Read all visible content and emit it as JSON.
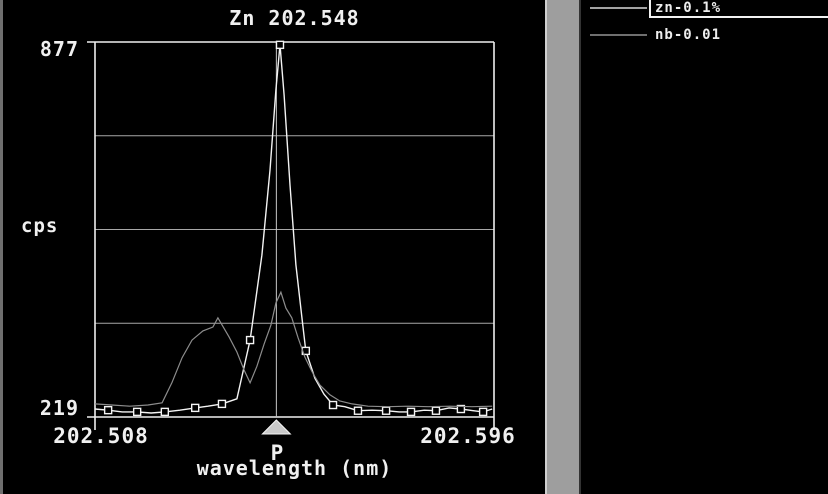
{
  "chart": {
    "title": "Zn 202.548",
    "y_axis": {
      "label": "cps",
      "max_label": "877",
      "min_label": "219"
    },
    "x_axis": {
      "label": "wavelength (nm)",
      "min_label": "202.508",
      "max_label": "202.596"
    },
    "peak_marker_label": "P"
  },
  "legend": {
    "items": [
      {
        "id": "zn",
        "label": "zn-0.1%",
        "sample_color": "#a2a2a2",
        "selected": true
      },
      {
        "id": "nb",
        "label": "nb-0.01",
        "sample_color": "#6f6f6f",
        "selected": false
      }
    ]
  },
  "colors": {
    "background": "#000000",
    "axis": "#efefef",
    "grid": "#a8a8a8",
    "center_line": "#c8c8c8",
    "peak_triangle": "#c9c9c9",
    "text": "#f0f0f0"
  },
  "chart_data": {
    "type": "line",
    "title": "Zn 202.548",
    "xlabel": "wavelength (nm)",
    "ylabel": "cps",
    "xlim": [
      202.508,
      202.596
    ],
    "ylim": [
      219,
      877
    ],
    "grid": "horizontal",
    "gridlines_cps": [
      383.5,
      548,
      712.5
    ],
    "peak_wavelength": 202.548,
    "series": [
      {
        "name": "zn-0.1%",
        "color": "#f4f4f4",
        "marker": "open-square",
        "points": [
          [
            202.508,
            233,
            0
          ],
          [
            202.5109,
            231,
            1
          ],
          [
            202.514,
            228,
            0
          ],
          [
            202.5173,
            228,
            1
          ],
          [
            202.5204,
            226,
            0
          ],
          [
            202.5234,
            228,
            1
          ],
          [
            202.5267,
            231,
            0
          ],
          [
            202.5301,
            235,
            1
          ],
          [
            202.5329,
            238,
            0
          ],
          [
            202.536,
            242,
            1
          ],
          [
            202.5393,
            251,
            0
          ],
          [
            202.5422,
            354,
            1
          ],
          [
            202.5448,
            503,
            0
          ],
          [
            202.5466,
            652,
            0
          ],
          [
            202.5479,
            793,
            0
          ],
          [
            202.5488,
            872,
            1
          ],
          [
            202.5497,
            784,
            0
          ],
          [
            202.551,
            626,
            0
          ],
          [
            202.5523,
            486,
            0
          ],
          [
            202.5537,
            389,
            0
          ],
          [
            202.5545,
            335,
            1
          ],
          [
            202.5565,
            287,
            0
          ],
          [
            202.5585,
            259,
            0
          ],
          [
            202.5605,
            240,
            1
          ],
          [
            202.5631,
            237,
            0
          ],
          [
            202.566,
            230,
            1
          ],
          [
            202.5691,
            231,
            0
          ],
          [
            202.5722,
            230,
            1
          ],
          [
            202.5751,
            228,
            0
          ],
          [
            202.5777,
            228,
            1
          ],
          [
            202.5806,
            231,
            0
          ],
          [
            202.5832,
            230,
            1
          ],
          [
            202.5861,
            235,
            0
          ],
          [
            202.5887,
            233,
            1
          ],
          [
            202.5914,
            230,
            0
          ],
          [
            202.5936,
            228,
            1
          ],
          [
            202.5956,
            233,
            0
          ]
        ]
      },
      {
        "name": "nb-0.01",
        "color": "#8d8d8d",
        "marker": "none",
        "points": [
          [
            202.508,
            242,
            0
          ],
          [
            202.5117,
            240,
            0
          ],
          [
            202.5157,
            238,
            0
          ],
          [
            202.5197,
            240,
            0
          ],
          [
            202.5228,
            244,
            0
          ],
          [
            202.525,
            280,
            0
          ],
          [
            202.5272,
            323,
            0
          ],
          [
            202.5294,
            354,
            0
          ],
          [
            202.5318,
            370,
            0
          ],
          [
            202.534,
            377,
            0
          ],
          [
            202.5351,
            393,
            0
          ],
          [
            202.5376,
            359,
            0
          ],
          [
            202.5393,
            333,
            0
          ],
          [
            202.5409,
            301,
            0
          ],
          [
            202.5422,
            279,
            0
          ],
          [
            202.5437,
            308,
            0
          ],
          [
            202.5453,
            347,
            0
          ],
          [
            202.5468,
            380,
            0
          ],
          [
            202.5479,
            419,
            0
          ],
          [
            202.549,
            438,
            0
          ],
          [
            202.5501,
            410,
            0
          ],
          [
            202.5514,
            393,
            0
          ],
          [
            202.5528,
            358,
            0
          ],
          [
            202.5543,
            324,
            0
          ],
          [
            202.5559,
            298,
            0
          ],
          [
            202.5576,
            275,
            0
          ],
          [
            202.5598,
            258,
            0
          ],
          [
            202.562,
            247,
            0
          ],
          [
            202.5647,
            242,
            0
          ],
          [
            202.5682,
            238,
            0
          ],
          [
            202.5726,
            237,
            0
          ],
          [
            202.577,
            238,
            0
          ],
          [
            202.5815,
            237,
            0
          ],
          [
            202.5863,
            238,
            0
          ],
          [
            202.5911,
            237,
            0
          ],
          [
            202.5956,
            238,
            0
          ]
        ]
      }
    ]
  }
}
